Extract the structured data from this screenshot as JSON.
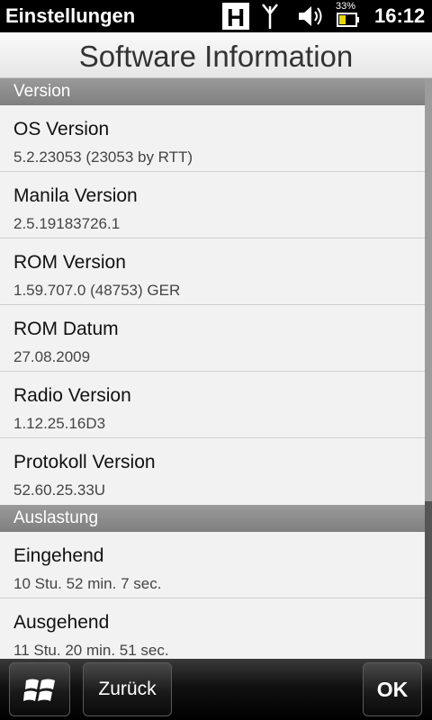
{
  "statusbar": {
    "app_title": "Einstellungen",
    "h_icon_letter": "H",
    "battery_percent": "33%",
    "time": "16:12",
    "icons": [
      "h-network-icon",
      "signal-icon",
      "volume-icon",
      "battery-icon"
    ]
  },
  "header": {
    "title": "Software Information"
  },
  "sections": [
    {
      "title": "Version",
      "items": [
        {
          "label": "OS Version",
          "value": "5.2.23053 (23053 by RTT)"
        },
        {
          "label": "Manila Version",
          "value": "2.5.19183726.1"
        },
        {
          "label": "ROM Version",
          "value": "1.59.707.0 (48753) GER"
        },
        {
          "label": "ROM Datum",
          "value": "27.08.2009"
        },
        {
          "label": "Radio Version",
          "value": "1.12.25.16D3"
        },
        {
          "label": "Protokoll Version",
          "value": "52.60.25.33U"
        }
      ]
    },
    {
      "title": "Auslastung",
      "items": [
        {
          "label": "Eingehend",
          "value": "10 Stu. 52 min. 7 sec."
        },
        {
          "label": "Ausgehend",
          "value": "11 Stu. 20 min. 51 sec."
        }
      ]
    }
  ],
  "bottombar": {
    "start_icon": "windows-start-icon",
    "back_label": "Zurück",
    "ok_label": "OK"
  },
  "colors": {
    "section_header": "#8c8c8c",
    "content_bg": "#f2f2f2",
    "bar_bg": "#000000"
  }
}
